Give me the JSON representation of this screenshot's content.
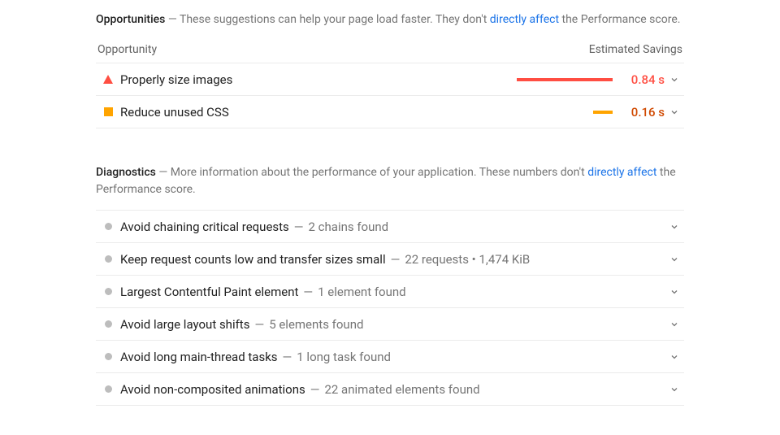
{
  "opportunities": {
    "title": "Opportunities",
    "desc_pre": " — These suggestions can help your page load faster. They don't ",
    "desc_link": "directly affect",
    "desc_post": " the Performance score.",
    "col_opportunity": "Opportunity",
    "col_savings": "Estimated Savings",
    "items": [
      {
        "label": "Properly size images",
        "savings": "0.84 s"
      },
      {
        "label": "Reduce unused CSS",
        "savings": "0.16 s"
      }
    ]
  },
  "diagnostics": {
    "title": "Diagnostics",
    "desc_pre": " — More information about the performance of your application. These numbers don't ",
    "desc_link": "directly affect",
    "desc_post": " the Performance score.",
    "items": [
      {
        "label": "Avoid chaining critical requests",
        "sub": "2 chains found"
      },
      {
        "label": "Keep request counts low and transfer sizes small",
        "sub": "22 requests • 1,474 KiB"
      },
      {
        "label": "Largest Contentful Paint element",
        "sub": "1 element found"
      },
      {
        "label": "Avoid large layout shifts",
        "sub": "5 elements found"
      },
      {
        "label": "Avoid long main-thread tasks",
        "sub": "1 long task found"
      },
      {
        "label": "Avoid non-composited animations",
        "sub": "22 animated elements found"
      }
    ]
  },
  "dash": " — "
}
